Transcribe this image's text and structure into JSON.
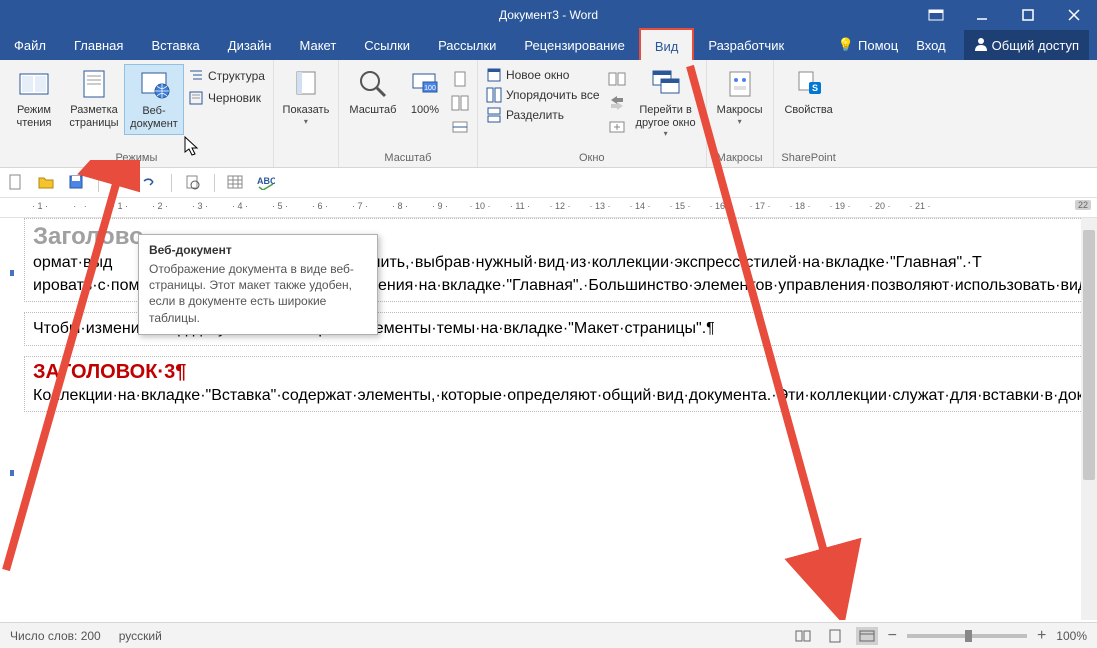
{
  "title": "Документ3 - Word",
  "tabs": {
    "file": "Файл",
    "home": "Главная",
    "insert": "Вставка",
    "design": "Дизайн",
    "layout": "Макет",
    "references": "Ссылки",
    "mailings": "Рассылки",
    "review": "Рецензирование",
    "view": "Вид",
    "developer": "Разработчик",
    "help_placeholder": "Помоц",
    "login": "Вход",
    "share": "Общий доступ"
  },
  "ribbon": {
    "views_group": "Режимы",
    "read_mode": "Режим чтения",
    "print_layout": "Разметка страницы",
    "web_layout": "Веб-документ",
    "outline": "Структура",
    "draft": "Черновик",
    "show": "Показать",
    "zoom_group": "Масштаб",
    "zoom": "Масштаб",
    "hundred": "100%",
    "window_group": "Окно",
    "new_window": "Новое окно",
    "arrange_all": "Упорядочить все",
    "split": "Разделить",
    "switch_windows": "Перейти в другое окно",
    "macros_group": "Макросы",
    "macros": "Макросы",
    "sharepoint_group": "SharePoint",
    "properties": "Свойства"
  },
  "tooltip": {
    "title": "Веб-документ",
    "body": "Отображение документа в виде веб-страницы. Этот макет также удобен, если в документе есть широкие таблицы."
  },
  "ruler_end": "22",
  "document": {
    "heading2": "Заголово",
    "para1": "ормат·выд                                               о·изменить,·выбрав·нужный·вид·из·коллекции·экспресс-стилей·на·вкладке·\"Главная\".·Т                                               ировать·с·помощью·других·элементов·управления·на·вкладке·\"Главная\".·Большинство·элементов·управления·позволяют·использовать·вид·из·текущей·темы·и·формат,·указанный·непосредственно.·¶",
    "para2": "Чтобы·изменить·вид·документа,·выберите·элементы·темы·на·вкладке·\"Макет·страницы\".¶",
    "heading3": "ЗАГОЛОВОК·3¶",
    "para3": "Коллекции·на·вкладке·\"Вставка\"·содержат·элементы,·которые·определяют·общий·вид·документа.·Эти·коллекции·служат·для·вставки·в·документ·таблиц,·колонтитулов,·списков,·титульных·страниц·и·других·стандартных·блоков.·При·создании·рисунков,·диаграмм·или·схем·они·согласовываются·с·видом·текущего·документа.¶"
  },
  "status": {
    "words": "Число слов: 200",
    "language": "русский",
    "zoom": "100%"
  }
}
